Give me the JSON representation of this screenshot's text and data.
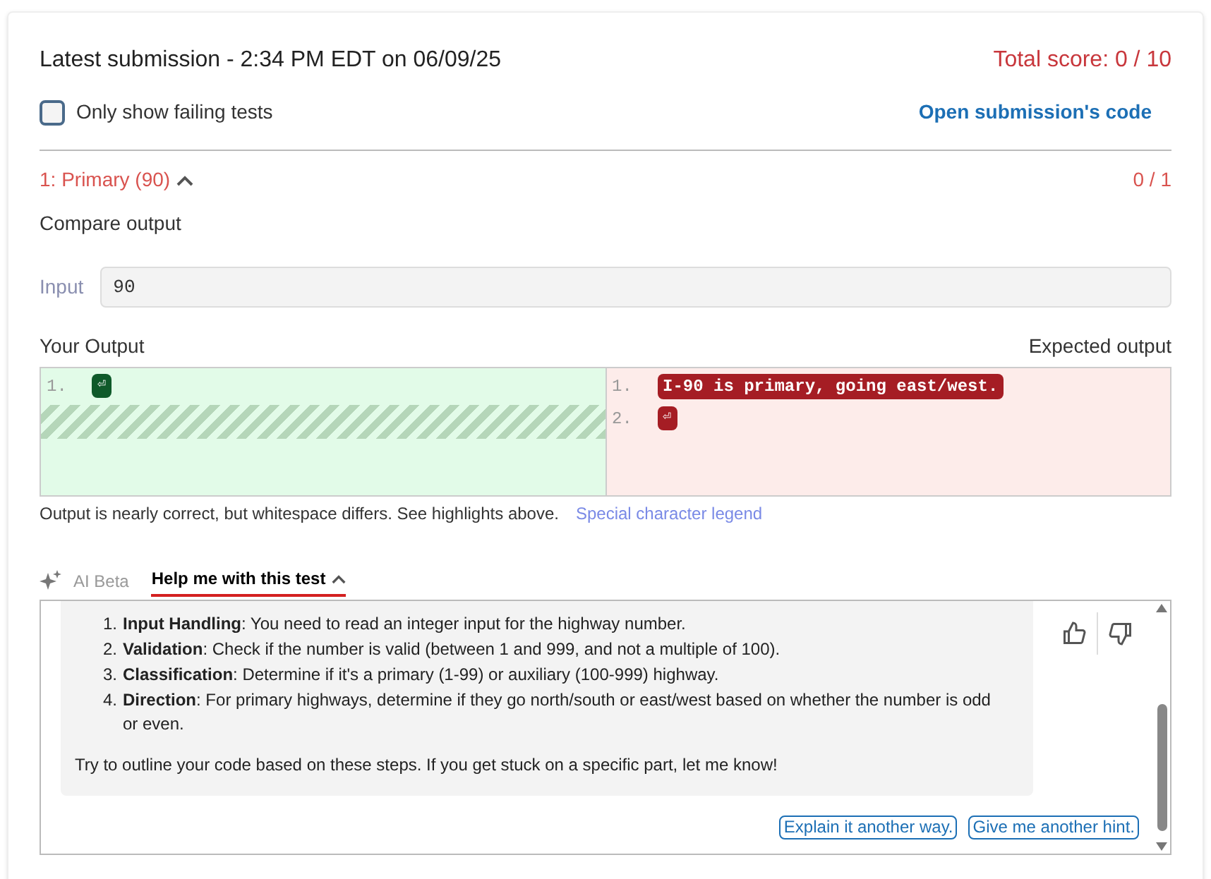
{
  "submission": {
    "title": "Latest submission - 2:34 PM EDT on 06/09/25",
    "total_score": "Total score: 0 / 10"
  },
  "filter": {
    "label": "Only show failing tests",
    "checked": false
  },
  "open_code_link": "Open submission's code",
  "test": {
    "title": "1: Primary (90)",
    "expanded": true,
    "score": "0 / 1",
    "kind_label": "Compare output",
    "input_label": "Input",
    "input_value": "90",
    "your_output": {
      "label": "Your Output",
      "lines": [
        {
          "number": "1.",
          "text": "⏎",
          "kind": "newline"
        },
        {
          "kind": "missing"
        }
      ]
    },
    "expected_output": {
      "label": "Expected output",
      "lines": [
        {
          "number": "1.",
          "text": "I-90 is primary, going east/west.",
          "kind": "text"
        },
        {
          "number": "2.",
          "text": "⏎",
          "kind": "newline"
        }
      ]
    },
    "note": "Output is nearly correct, but whitespace differs. See highlights above.",
    "legend_link": "Special character legend"
  },
  "ai": {
    "label": "AI Beta",
    "tab": "Help me with this test",
    "expanded": true,
    "steps": [
      {
        "number": "1.",
        "text": "**Input Handling**: You need to read an integer input for the highway number."
      },
      {
        "number": "2.",
        "text": "**Validation**: Check if the number is valid (between 1 and 999, and not a multiple of 100)."
      },
      {
        "number": "3.",
        "text": "**Classification**: Determine if it's a primary (1-99) or auxiliary (100-999) highway."
      },
      {
        "number": "4.",
        "text": "**Direction**: For primary highways, determine if they go north/south or east/west based on whether the number is odd or even."
      }
    ],
    "closing": "Try to outline your code based on these steps. If you get stuck on a specific part, let me know!",
    "buttons": [
      "Explain it another way.",
      "Give me another hint."
    ]
  }
}
